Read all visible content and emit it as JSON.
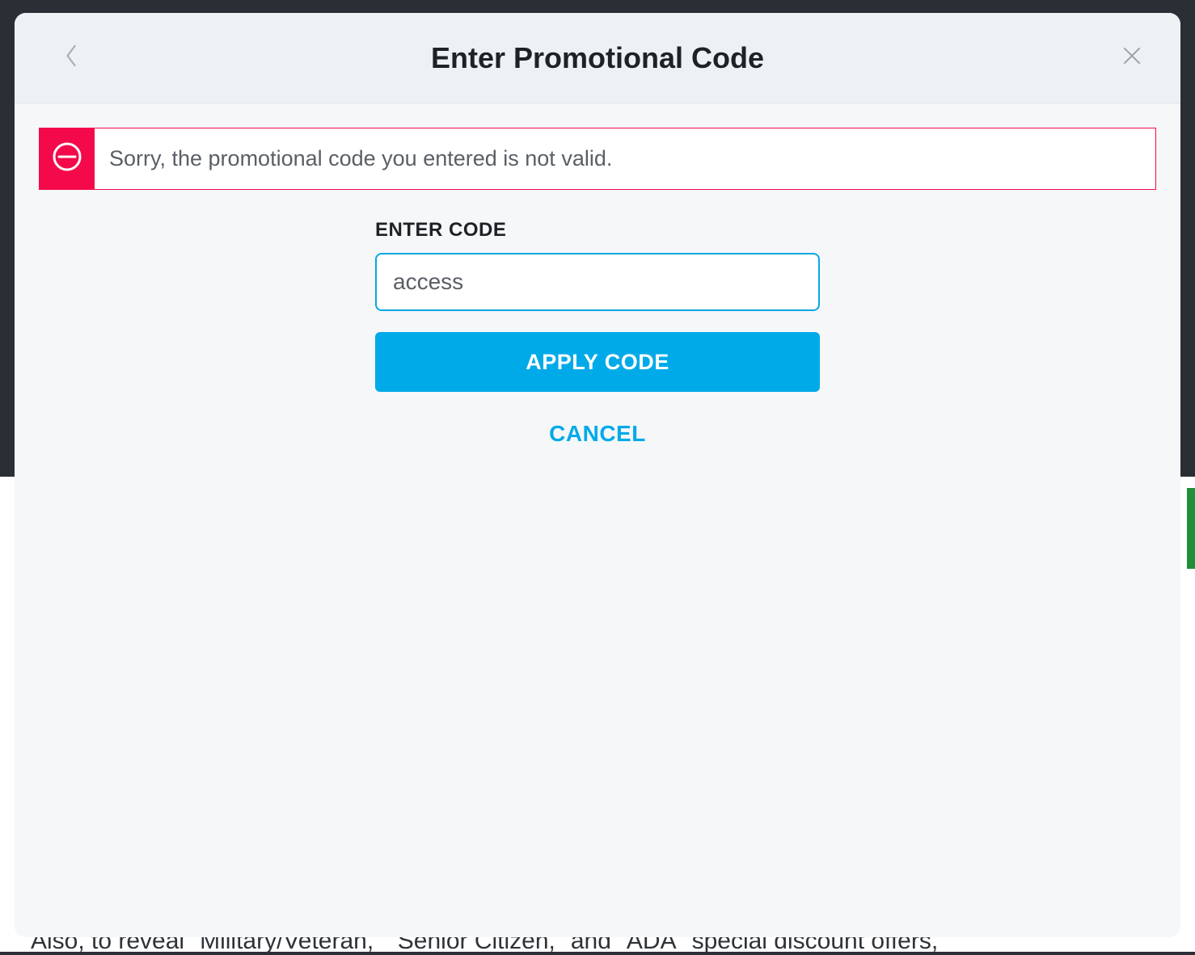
{
  "modal": {
    "title": "Enter Promotional Code"
  },
  "alert": {
    "message": "Sorry, the promotional code you entered is not valid."
  },
  "form": {
    "label": "ENTER CODE",
    "code_value": "access",
    "apply_label": "APPLY CODE",
    "cancel_label": "CANCEL"
  },
  "background": {
    "partial_text": "Also, to reveal \"Military/Veteran,\" \"Senior Citizen,\" and \"ADA\" special discount offers,"
  },
  "colors": {
    "accent_blue": "#00aae8",
    "error_red": "#f40a4a",
    "header_bg": "#eef1f4",
    "body_bg": "#f5f7f9"
  }
}
